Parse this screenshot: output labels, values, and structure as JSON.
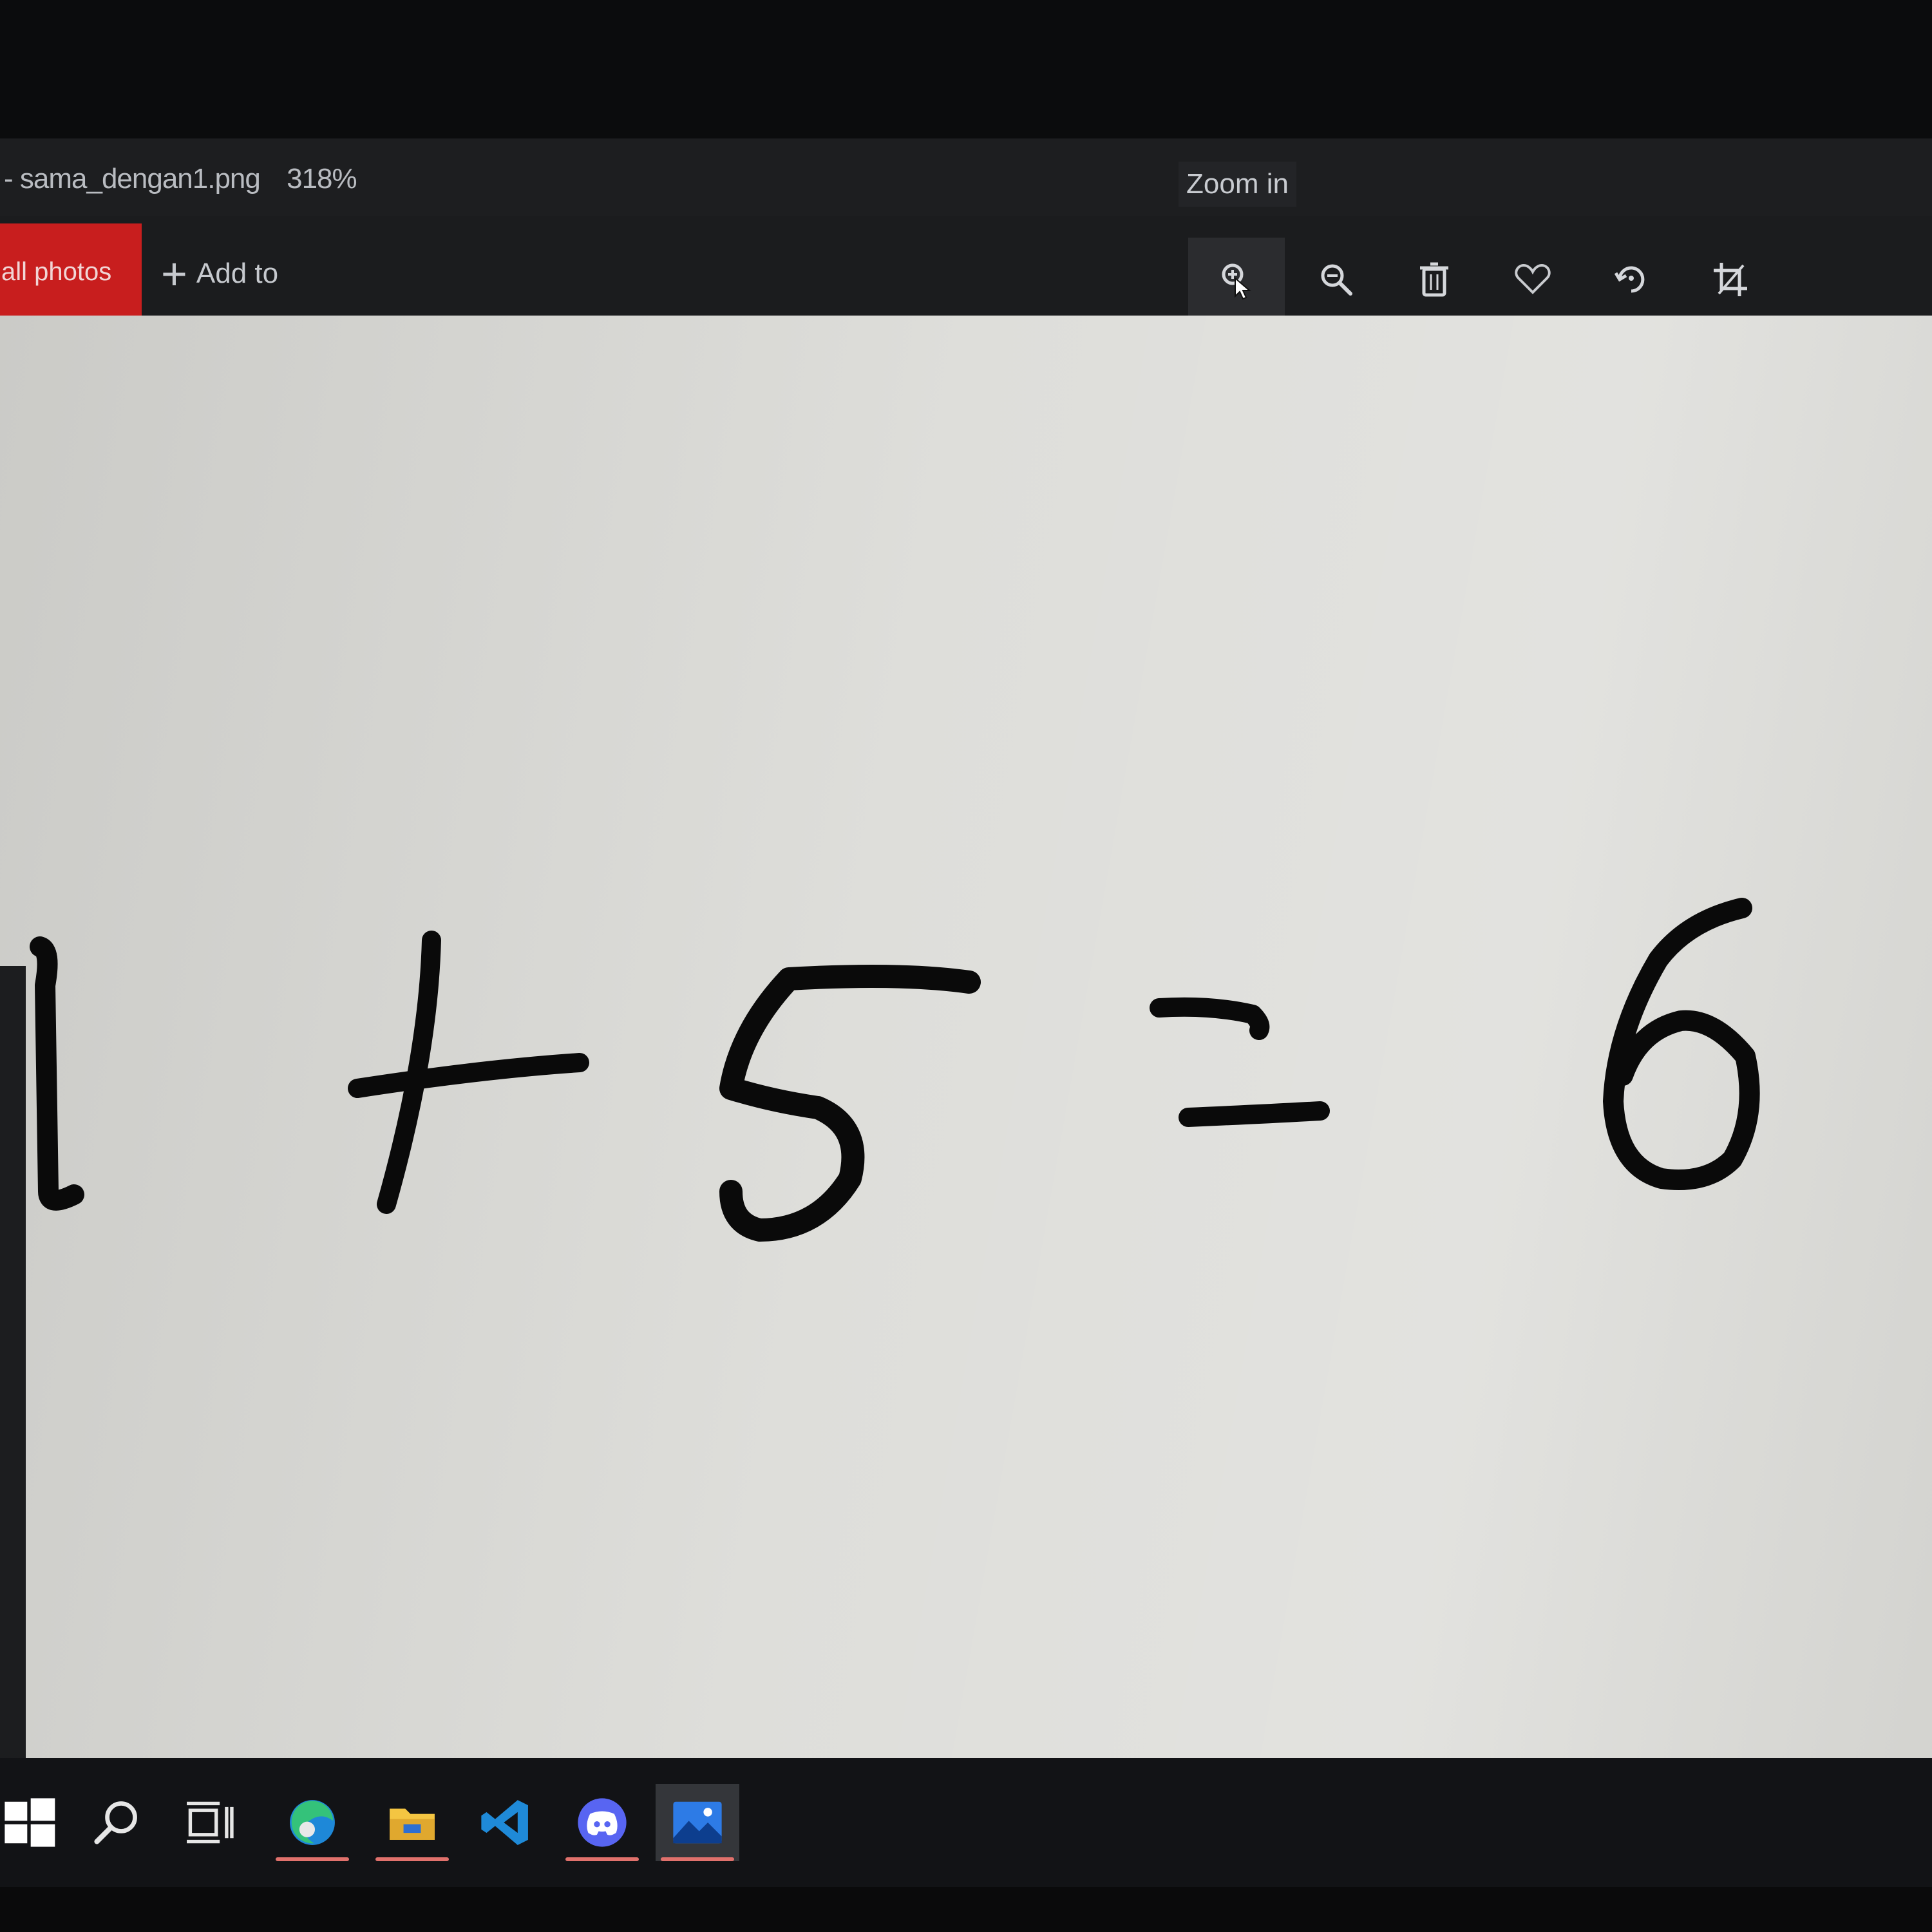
{
  "window": {
    "title": "- sama_dengan1.png",
    "zoom_level": "318%"
  },
  "tooltip": {
    "text": "Zoom in"
  },
  "toolbar": {
    "all_photos_label": "all photos",
    "add_to_label": "Add to",
    "icons": [
      "zoom-in-icon",
      "zoom-out-icon",
      "delete-icon",
      "favorite-heart-icon",
      "rotate-icon",
      "crop-icon"
    ]
  },
  "image": {
    "content": "1 + 5 = 6"
  },
  "taskbar": {
    "items": [
      "windows-start-icon",
      "search-icon",
      "task-view-icon",
      "edge-icon",
      "file-explorer-icon",
      "vscode-icon",
      "discord-icon",
      "photos-icon"
    ],
    "accent_color": "#e0716c"
  },
  "colors": {
    "accent_red": "#c81e1e",
    "toolbar_bg": "#1b1c1e",
    "ink": "#0a0a0a"
  }
}
